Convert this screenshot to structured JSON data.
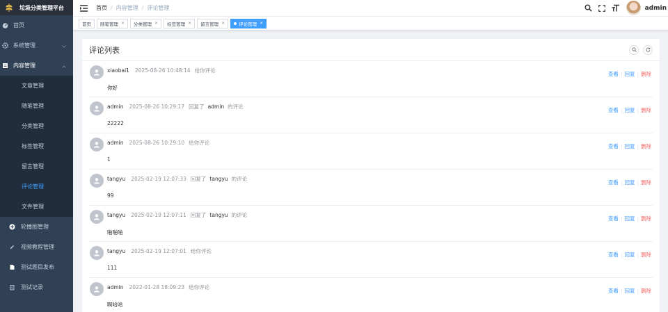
{
  "app": {
    "title": "垃圾分类管理平台"
  },
  "sidebar": {
    "items": [
      {
        "label": "首页",
        "icon": "dashboard-icon",
        "type": "top"
      },
      {
        "label": "系统管理",
        "icon": "gear-icon",
        "type": "top",
        "arrow": "chevron-down"
      },
      {
        "label": "内容管理",
        "icon": "document-icon",
        "type": "top-open",
        "arrow": "chevron-up"
      },
      {
        "label": "文章管理",
        "type": "sub"
      },
      {
        "label": "随笔管理",
        "type": "sub"
      },
      {
        "label": "分类管理",
        "type": "sub"
      },
      {
        "label": "标签管理",
        "type": "sub"
      },
      {
        "label": "留言管理",
        "type": "sub"
      },
      {
        "label": "评论管理",
        "type": "sub-active"
      },
      {
        "label": "文件管理",
        "type": "sub"
      },
      {
        "label": "轮播图管理",
        "icon": "plus-circle-icon",
        "type": "l2"
      },
      {
        "label": "视频教程管理",
        "icon": "pencil-icon",
        "type": "l2"
      },
      {
        "label": "测试题目发布",
        "icon": "file-icon",
        "type": "l2"
      },
      {
        "label": "测试记录",
        "icon": "clipboard-icon",
        "type": "l2"
      }
    ]
  },
  "navbar": {
    "breadcrumb": [
      "首页",
      "内容管理",
      "评论管理"
    ],
    "username": "admin"
  },
  "tags": [
    {
      "label": "首页",
      "active": false,
      "closable": false
    },
    {
      "label": "随笔管理",
      "active": false,
      "closable": true
    },
    {
      "label": "分类管理",
      "active": false,
      "closable": true
    },
    {
      "label": "标签管理",
      "active": false,
      "closable": true
    },
    {
      "label": "留言管理",
      "active": false,
      "closable": true
    },
    {
      "label": "评论管理",
      "active": true,
      "closable": true
    }
  ],
  "card": {
    "title": "评论列表"
  },
  "ops": {
    "view": "查看",
    "reply": "回复",
    "delete": "删除"
  },
  "comments": [
    {
      "user": "xiaobai1",
      "time": "2025-08-26 10:48:14",
      "action": "给你评论",
      "target": "",
      "suffix": "",
      "content": "你好"
    },
    {
      "user": "admin",
      "time": "2025-08-26 10:29:17",
      "action": "回复了",
      "target": "admin",
      "suffix": "的评论",
      "content": "22222"
    },
    {
      "user": "admin",
      "time": "2025-08-26 10:29:10",
      "action": "给你评论",
      "target": "",
      "suffix": "",
      "content": "1"
    },
    {
      "user": "tangyu",
      "time": "2025-02-19 12:07:33",
      "action": "回复了",
      "target": "tangyu",
      "suffix": "的评论",
      "content": "99"
    },
    {
      "user": "tangyu",
      "time": "2025-02-19 12:07:11",
      "action": "回复了",
      "target": "tangyu",
      "suffix": "的评论",
      "content": "啪啪啪"
    },
    {
      "user": "tangyu",
      "time": "2025-02-19 12:07:01",
      "action": "给你评论",
      "target": "",
      "suffix": "",
      "content": "111"
    },
    {
      "user": "admin",
      "time": "2022-01-28 18:09:23",
      "action": "给你评论",
      "target": "",
      "suffix": "",
      "content": "啊哈哈"
    }
  ],
  "colors": {
    "sidebar_bg": "#304156",
    "accent": "#409eff",
    "danger": "#f56c6c"
  }
}
